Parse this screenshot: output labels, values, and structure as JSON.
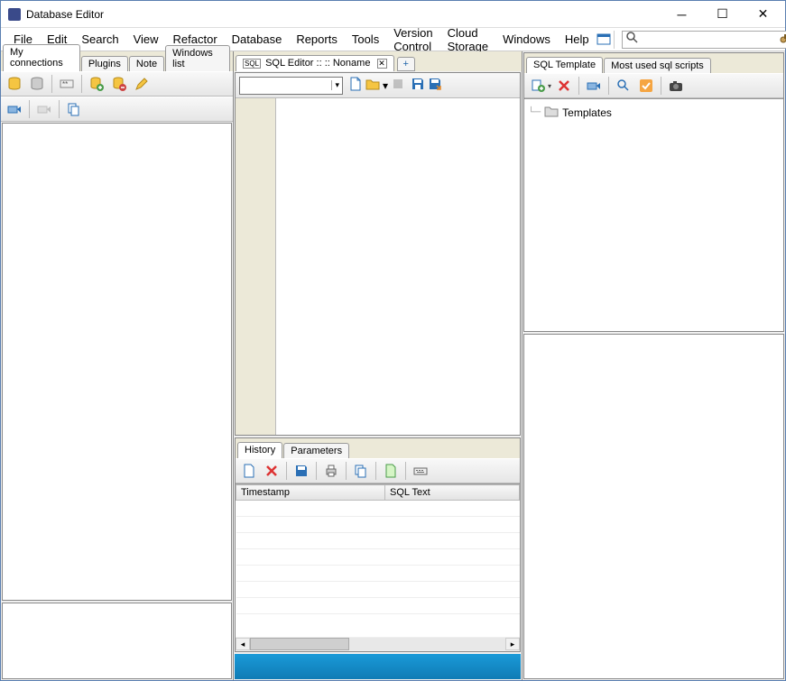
{
  "window": {
    "title": "Database Editor"
  },
  "menu": {
    "items": [
      "File",
      "Edit",
      "Search",
      "View",
      "Refactor",
      "Database",
      "Reports",
      "Tools",
      "Version Control",
      "Cloud Storage",
      "Windows",
      "Help"
    ]
  },
  "left": {
    "tabs": [
      "My connections",
      "Plugins",
      "Note",
      "Windows list"
    ],
    "active_tab": 0
  },
  "center": {
    "editor_tab": "SQL Editor ::  :: Noname",
    "history_tabs": [
      "History",
      "Parameters"
    ],
    "history_active": 0,
    "history_columns": [
      "Timestamp",
      "SQL Text"
    ]
  },
  "right": {
    "tabs": [
      "SQL Template",
      "Most used sql scripts"
    ],
    "active_tab": 0,
    "tree_root": "Templates"
  },
  "icons": {
    "db_yellow": "database-icon",
    "db_grey": "database-grey-icon",
    "asterisk": "asterisk-icon",
    "add": "add-icon",
    "remove": "remove-icon",
    "pencil": "pencil-icon",
    "connect": "connect-icon",
    "disconnect": "disconnect-icon",
    "copy": "copy-icon",
    "new_doc": "new-doc-icon",
    "open": "open-folder-icon",
    "stop": "stop-icon",
    "save": "save-icon",
    "save_as": "save-as-icon",
    "delete": "delete-icon",
    "print": "print-icon",
    "export": "export-icon",
    "keyboard": "keyboard-icon",
    "new_tpl": "new-template-icon",
    "remove_tpl": "remove-template-icon",
    "refresh_tpl": "refresh-icon",
    "search": "search-icon",
    "check": "check-icon",
    "camera": "camera-icon",
    "binoculars": "binoculars-icon",
    "window": "window-icon"
  }
}
